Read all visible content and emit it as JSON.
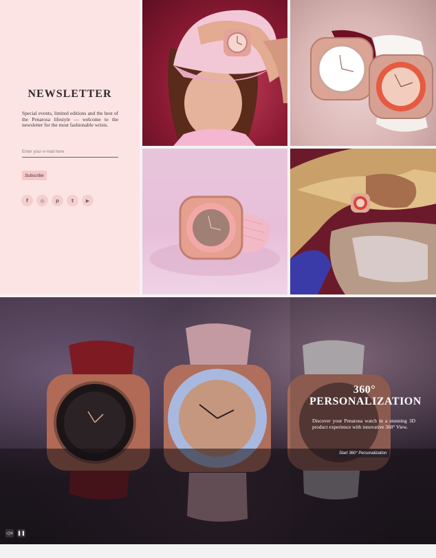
{
  "newsletter": {
    "title": "NEWSLETTER",
    "description": "Special events, limited editions and the best of the Penarosa lifestyle — welcome to the newsletter for the most fashionable wrists.",
    "email_placeholder": "Enter your e-mail here",
    "subscribe_label": "Subscribe",
    "socials": [
      {
        "icon": "facebook-icon",
        "glyph": "f"
      },
      {
        "icon": "instagram-icon",
        "glyph": "◎"
      },
      {
        "icon": "pinterest-icon",
        "glyph": "p"
      },
      {
        "icon": "twitter-icon",
        "glyph": "t"
      },
      {
        "icon": "youtube-icon",
        "glyph": "▶"
      }
    ]
  },
  "gallery": [
    {
      "name": "model-cap-photo"
    },
    {
      "name": "two-watches-photo"
    },
    {
      "name": "pink-watch-photo"
    },
    {
      "name": "gold-jacket-photo"
    }
  ],
  "hero": {
    "title_line1": "360°",
    "title_line2": "PERSONALIZATION",
    "description": "Discover your Penarosa watch in a stunning 3D product experience with innovative 360° View.",
    "button_label": "Start 360° Personalization",
    "watch_brand": "Penarosa"
  },
  "controls": {
    "mute_icon": "mute-icon",
    "pause_icon": "pause-icon"
  },
  "colors": {
    "accent_pink": "#fde4e4",
    "button_pink": "#f5c8c7",
    "maroon": "#8b1a33"
  }
}
